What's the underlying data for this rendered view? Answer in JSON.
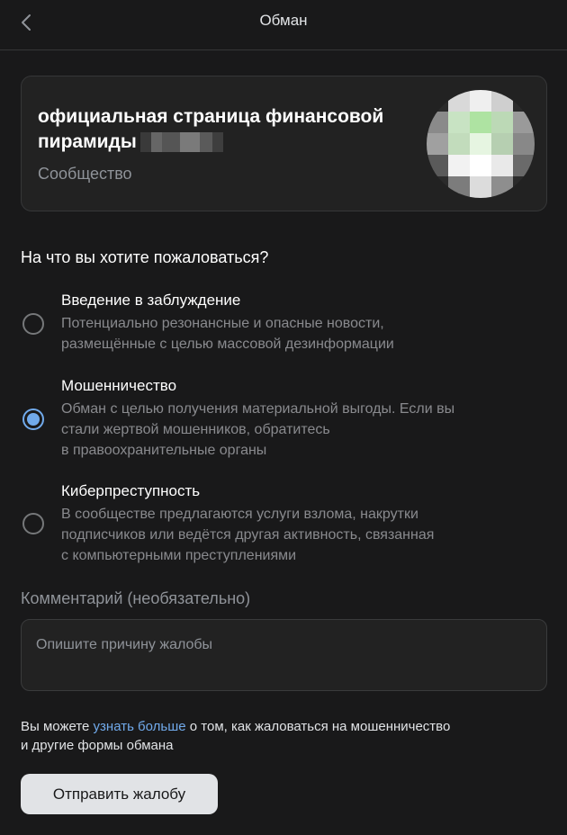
{
  "header": {
    "title": "Обман",
    "back_icon": "chevron-left-icon"
  },
  "community": {
    "title": "официальная страница финансовой пирамиды",
    "subtitle": "Сообщество",
    "avatar_icon": "pixelated-avatar"
  },
  "question": "На что вы хотите пожаловаться?",
  "options": [
    {
      "title": "Введение в заблуждение",
      "description_lines": [
        "Потенциально резонансные и опасные новости,",
        "размещённые с целью массовой дезинформации"
      ],
      "checked": false
    },
    {
      "title": "Мошенничество",
      "description_lines": [
        "Обман с целью получения материальной выгоды. Если вы",
        "стали жертвой мошенников, обратитесь",
        "в правоохранительные органы"
      ],
      "checked": true
    },
    {
      "title": "Киберпреступность",
      "description_lines": [
        "В сообществе предлагаются услуги взлома, накрутки",
        "подписчиков или ведётся другая активность, связанная",
        "с компьютерными преступлениями"
      ],
      "checked": false
    }
  ],
  "comment": {
    "label": "Комментарий (необязательно)",
    "placeholder": "Опишите причину жалобы",
    "value": ""
  },
  "info": {
    "prefix": "Вы можете ",
    "link": "узнать больше",
    "suffix_line1": " о том, как жаловаться на мошенничество",
    "line2": "и другие формы обмана"
  },
  "submit_label": "Отправить жалобу",
  "colors": {
    "background": "#19191a",
    "card": "#222222",
    "accent": "#71aaeb",
    "button": "#e1e3e6"
  }
}
